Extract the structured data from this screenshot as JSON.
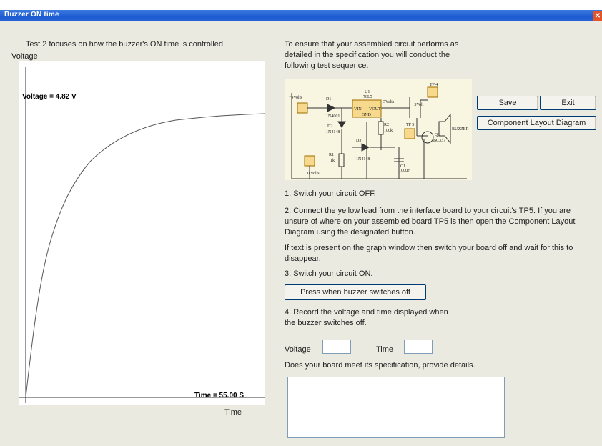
{
  "window": {
    "title": "Buzzer ON time"
  },
  "left": {
    "heading": "Test 2 focuses on how the buzzer's ON time is controlled.",
    "y_label": "Voltage",
    "x_label": "Time",
    "voltage_readout": "Voltage =   4.82 V",
    "time_readout": "Time =   55.00 S"
  },
  "intro": "To ensure that your assembled circuit performs as detailed in the specification you will conduct the following test sequence.",
  "circuit": {
    "plus9": "+9Volts",
    "zero": "0 Volts",
    "d1": "D1",
    "d1_part": "1N4001",
    "d2": "D2",
    "d2_part": "1N4148",
    "d3": "D3",
    "d3_part": "1N4148",
    "u1": "U1",
    "u1_part": "78L5",
    "vin": "VIN",
    "vout": "VOUT",
    "gnd": "GND",
    "five": "5Volts",
    "five2": "+5Volt",
    "r1": "R1",
    "r1_val": "1k",
    "r2": "R2",
    "r2_val": "100k",
    "c1": "C1",
    "c1_val": "100uF",
    "q1": "Q1",
    "q1_part": "BC337",
    "tp4": "TP 4",
    "tp5": "TP 5",
    "buzzer": "BUZZER"
  },
  "buttons": {
    "save": "Save",
    "exit": "Exit",
    "layout": "Component Layout Diagram",
    "press": "Press when buzzer switches off"
  },
  "steps": {
    "s1": "1.  Switch your circuit OFF.",
    "s2": "2.  Connect the yellow lead from the interface board to your circuit's TP5. If you are unsure of where on your assembled board TP5 is then open the Component Layout Diagram using the designated button.",
    "s2b": "If text is present on the graph window then switch your board off and wait for this to disappear.",
    "s3": "3.  Switch your circuit ON.",
    "s4": "4.  Record the voltage and time displayed when the buzzer switches off."
  },
  "fields": {
    "voltage_label": "Voltage",
    "time_label": "Time",
    "voltage_value": "",
    "time_value": "",
    "question": "Does your board meet its specification, provide details.",
    "details_value": ""
  },
  "colors": {
    "titlebar": "#1d5ad0",
    "panel": "#ebeae0",
    "circuit_bg": "#f8f6e0"
  }
}
